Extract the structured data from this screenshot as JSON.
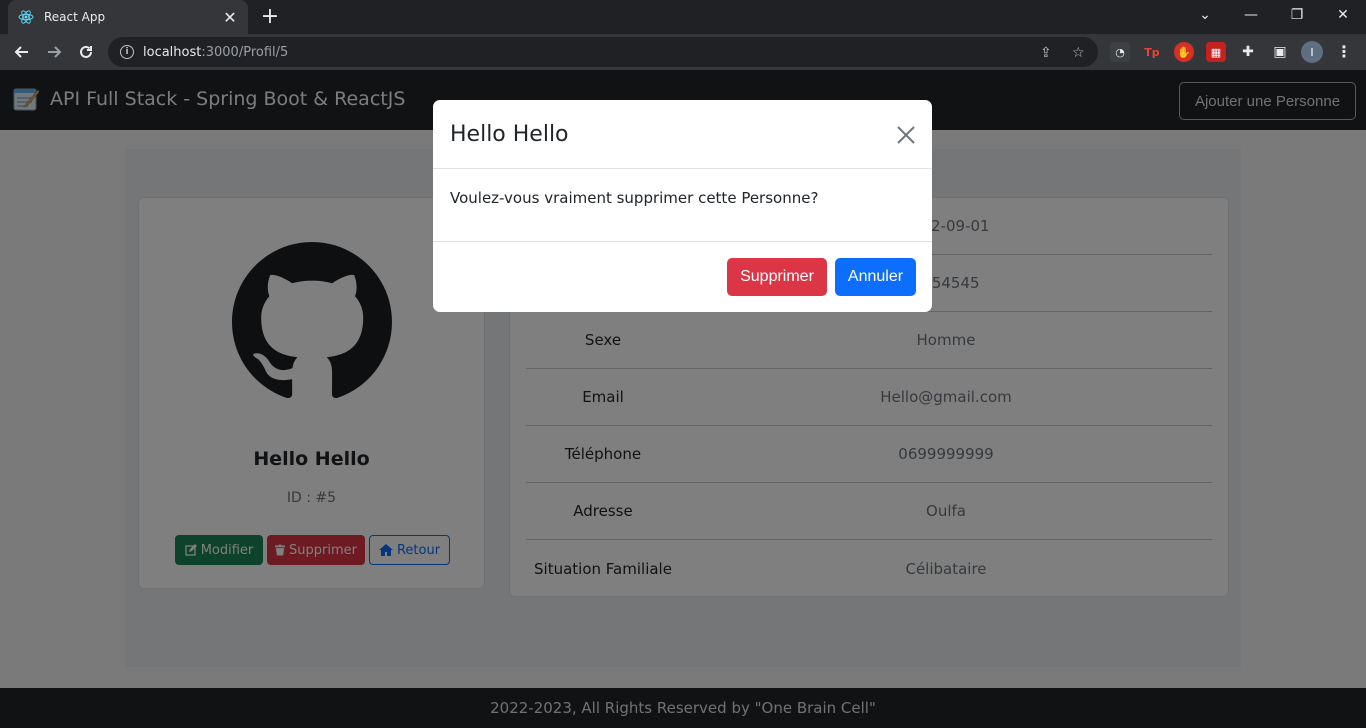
{
  "browser": {
    "tab_title": "React App",
    "url_host": "localhost",
    "url_path": ":3000/Profil/5",
    "profile_initial": "I",
    "ext_tp_label": "Tp"
  },
  "app": {
    "brand": "API Full Stack - Spring Boot & ReactJS",
    "add_button": "Ajouter une Personne"
  },
  "profile": {
    "name": "Hello Hello",
    "id_label": "ID : #5",
    "buttons": {
      "edit": "Modifier",
      "delete": "Supprimer",
      "back": "Retour"
    }
  },
  "details": [
    {
      "label": "",
      "value": "2022-09-01"
    },
    {
      "label": "",
      "value": "K454545"
    },
    {
      "label": "Sexe",
      "value": "Homme"
    },
    {
      "label": "Email",
      "value": "Hello@gmail.com"
    },
    {
      "label": "Téléphone",
      "value": "0699999999"
    },
    {
      "label": "Adresse",
      "value": "Oulfa"
    },
    {
      "label": "Situation Familiale",
      "value": "Célibataire"
    }
  ],
  "footer": "2022-2023, All Rights Reserved by \"One Brain Cell\"",
  "modal": {
    "title": "Hello Hello",
    "message": "Voulez-vous vraiment supprimer cette Personne?",
    "confirm": "Supprimer",
    "cancel": "Annuler"
  },
  "colors": {
    "danger": "#dc3545",
    "primary": "#0d6efd",
    "success": "#198754",
    "navbar": "#212529"
  }
}
